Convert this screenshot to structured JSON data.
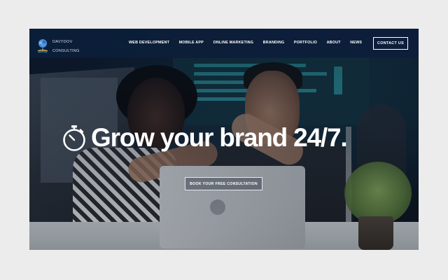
{
  "brand": {
    "name_line1": "DAVYDOV",
    "name_line2": "CONSULTING",
    "logo_icon": "tree-logo-icon"
  },
  "nav": {
    "items": [
      {
        "label": "WEB DEVELOPMENT"
      },
      {
        "label": "MOBILE APP"
      },
      {
        "label": "ONLINE MARKETING"
      },
      {
        "label": "BRANDING"
      },
      {
        "label": "PORTFOLIO"
      },
      {
        "label": "ABOUT"
      },
      {
        "label": "NEWS"
      }
    ],
    "contact_label": "CONTACT US"
  },
  "hero": {
    "icon": "stopwatch-icon",
    "title": "Grow your brand 24/7.",
    "cta_label": "BOOK YOUR FREE CONSULTATION"
  },
  "colors": {
    "header_bg": "#0c1e3a",
    "text": "#ffffff",
    "page_bg": "#ececec"
  }
}
